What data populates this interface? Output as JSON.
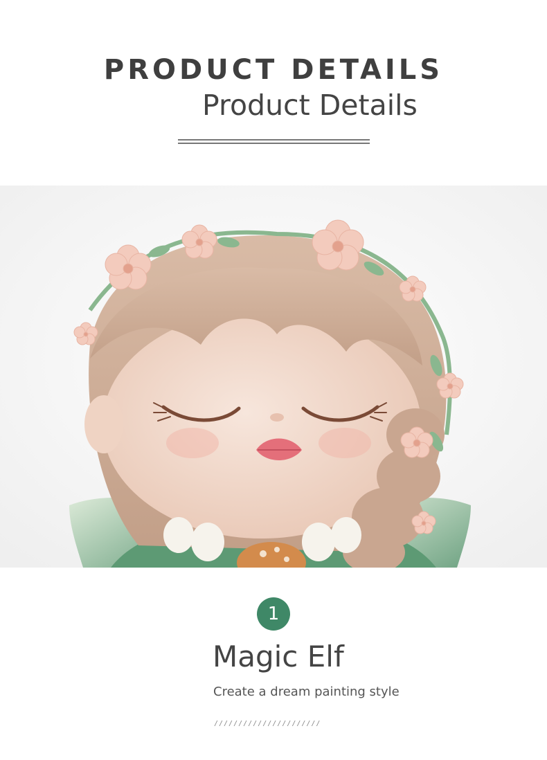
{
  "header": {
    "title": "PRODUCT DETAILS",
    "subtitle": "Product Details"
  },
  "photo": {
    "icon": "elf-figurine-photo"
  },
  "feature": {
    "number": "1",
    "title": "Magic Elf",
    "description": "Create a dream painting style",
    "decor": "//////////////////////"
  },
  "colors": {
    "badge": "#3f8867",
    "text": "#444444",
    "skin": "#f2d9cb",
    "hair": "#cfae99",
    "flower": "#f1c4b4",
    "leaf": "#7fae8c"
  }
}
